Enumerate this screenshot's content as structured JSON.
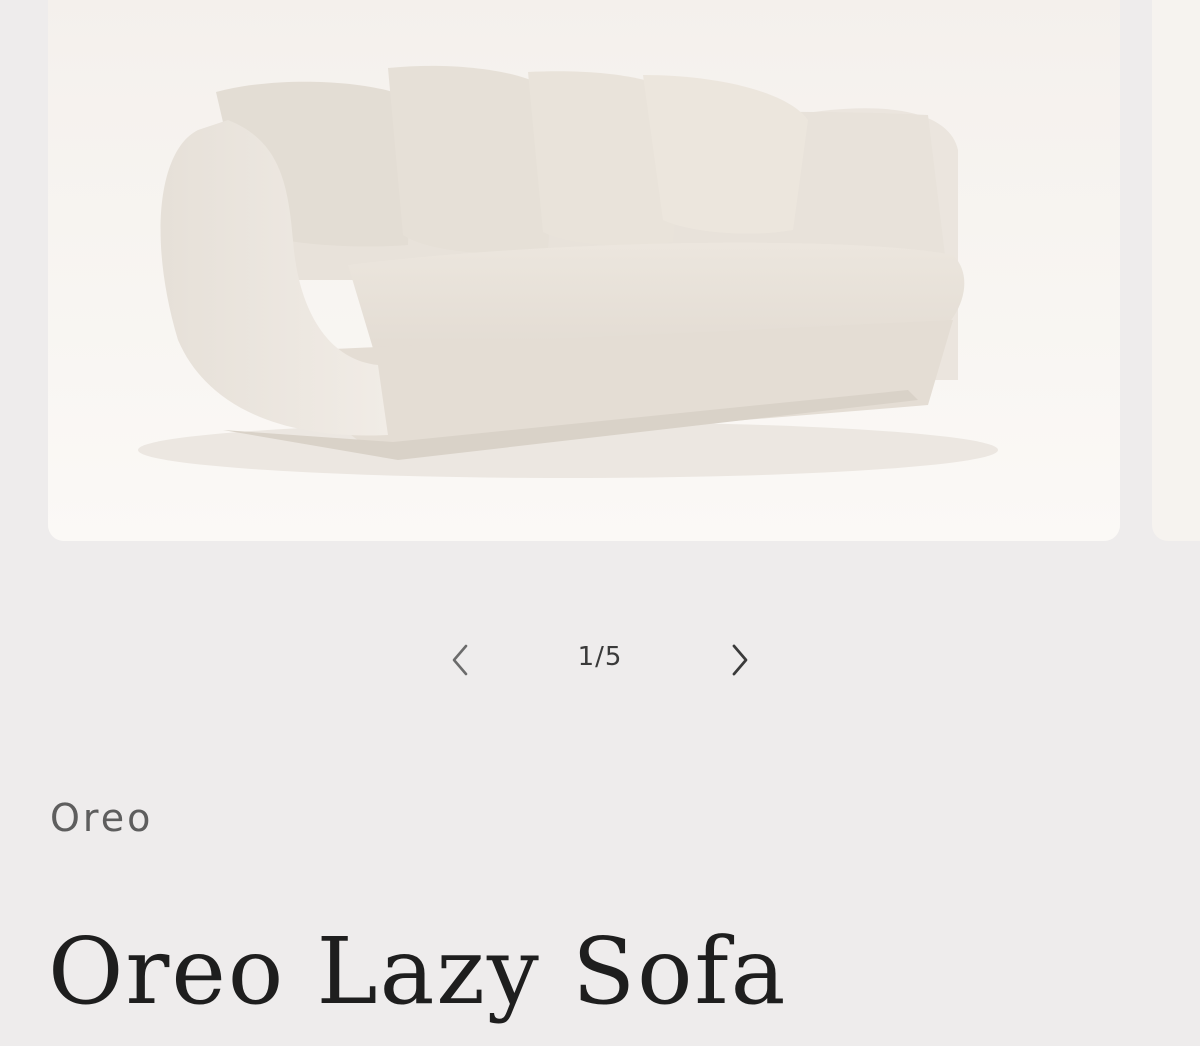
{
  "gallery": {
    "image_alt": "Oreo Lazy Sofa",
    "counter": "1/5",
    "prev_icon": "chevron-left-icon",
    "next_icon": "chevron-right-icon"
  },
  "product": {
    "vendor": "Oreo",
    "title": "Oreo Lazy Sofa"
  },
  "colors": {
    "background": "#eeecec",
    "image_background": "#f8f5f1",
    "sofa_fabric": "#ebe5dd",
    "icon": "#555555"
  }
}
